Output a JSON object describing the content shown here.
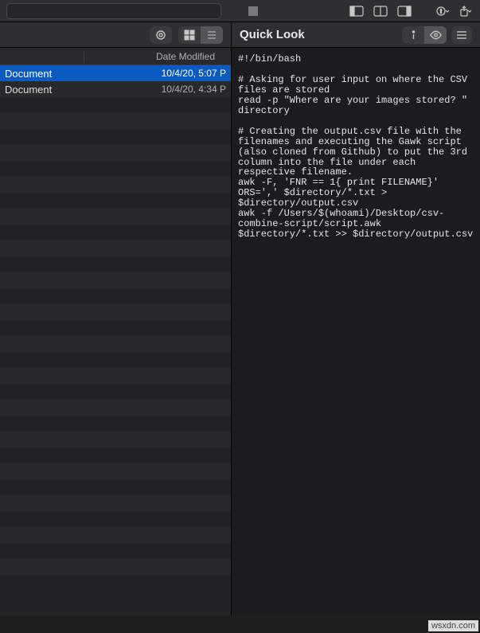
{
  "toolbar": {
    "search_placeholder": ""
  },
  "left": {
    "column_header": "Date Modified",
    "rows": [
      {
        "name": "Document",
        "date": "10/4/20, 5:07 P",
        "selected": true
      },
      {
        "name": "Document",
        "date": "10/4/20, 4:34 P",
        "selected": false
      }
    ]
  },
  "quicklook": {
    "title": "Quick Look",
    "code": "#!/bin/bash\n\n# Asking for user input on where the CSV files are stored\nread -p \"Where are your images stored? \" directory\n\n# Creating the output.csv file with the filenames and executing the Gawk script (also cloned from Github) to put the 3rd column into the file under each respective filename.\nawk -F, 'FNR == 1{ print FILENAME}' ORS=',' $directory/*.txt > $directory/output.csv\nawk -f /Users/$(whoami)/Desktop/csv-combine-script/script.awk $directory/*.txt >> $directory/output.csv"
  },
  "watermark": "wsxdn.com"
}
